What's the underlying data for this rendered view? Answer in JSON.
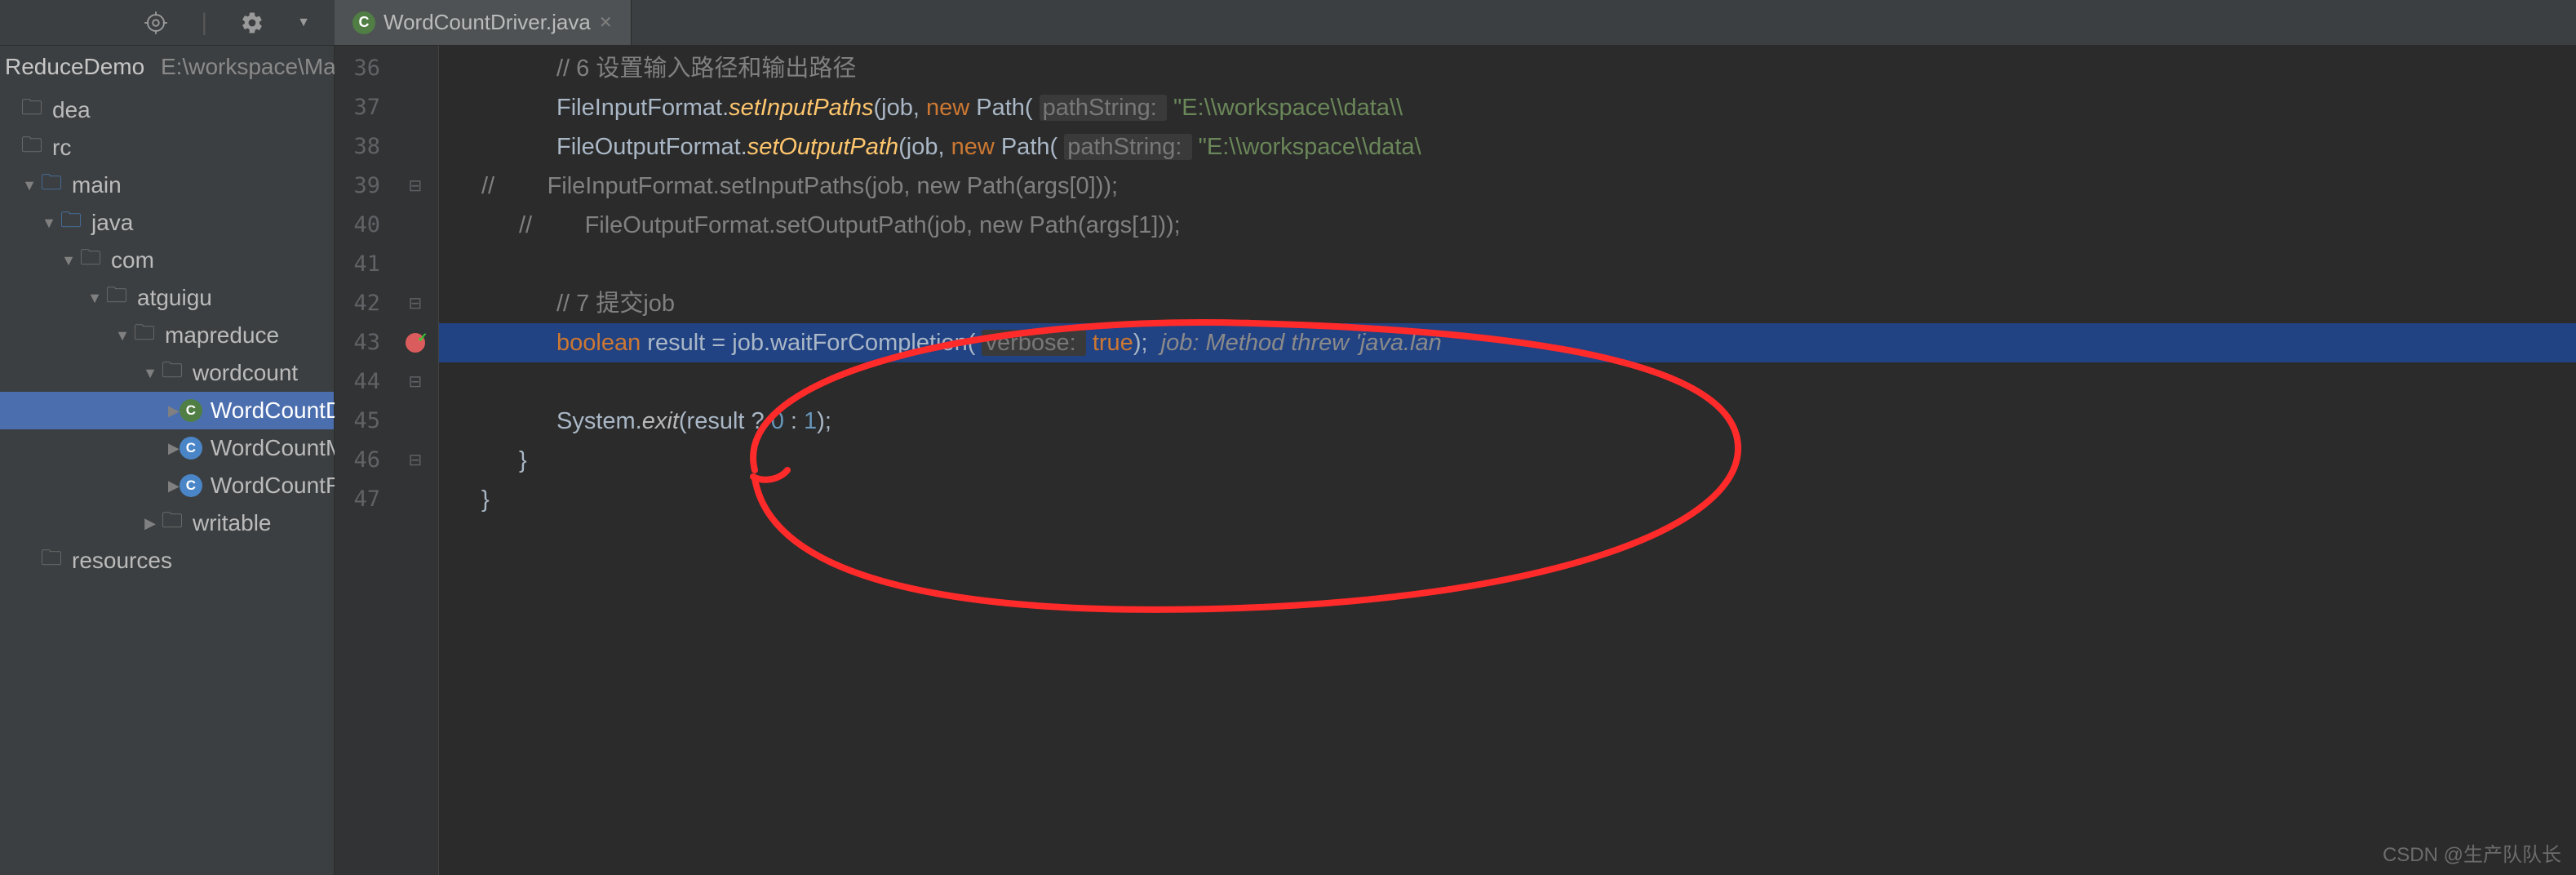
{
  "tab": {
    "name": "WordCountDriver.java"
  },
  "crumb": {
    "project": "ReduceDemo",
    "path": "E:\\workspace\\MapReduceDem"
  },
  "tree": [
    {
      "depth": 0,
      "arrow": "none",
      "icon": "folder-plain",
      "glyph": "🗀",
      "label": "dea"
    },
    {
      "depth": 0,
      "arrow": "none",
      "icon": "folder-plain",
      "glyph": "🗀",
      "label": "rc"
    },
    {
      "depth": 1,
      "arrow": "down",
      "icon": "folder-blue",
      "glyph": "🗀",
      "label": "main"
    },
    {
      "depth": 2,
      "arrow": "down",
      "icon": "folder-blue",
      "glyph": "🗀",
      "label": "java"
    },
    {
      "depth": 3,
      "arrow": "down",
      "icon": "folder-grey",
      "glyph": "🗀",
      "label": "com"
    },
    {
      "depth": 4,
      "arrow": "down",
      "icon": "folder-grey",
      "glyph": "🗀",
      "label": "atguigu"
    },
    {
      "depth": 5,
      "arrow": "down",
      "icon": "folder-grey",
      "glyph": "🗀",
      "label": "mapreduce"
    },
    {
      "depth": 6,
      "arrow": "down",
      "icon": "folder-grey",
      "glyph": "🗀",
      "label": "wordcount"
    },
    {
      "depth": 7,
      "arrow": "right",
      "icon": "class-g",
      "glyph": "C",
      "label": "WordCountDriver",
      "sel": true
    },
    {
      "depth": 7,
      "arrow": "right",
      "icon": "class-b",
      "glyph": "C",
      "label": "WordCountMapper"
    },
    {
      "depth": 7,
      "arrow": "right",
      "icon": "class-b",
      "glyph": "C",
      "label": "WordCountReducer"
    },
    {
      "depth": 6,
      "arrow": "right",
      "icon": "folder-grey",
      "glyph": "🗀",
      "label": "writable"
    },
    {
      "depth": 1,
      "arrow": "none",
      "icon": "folder-plain",
      "glyph": "🗀",
      "label": "resources"
    }
  ],
  "gutter": [
    "36",
    "37",
    "38",
    "39",
    "40",
    "41",
    "42",
    "43",
    "44",
    "45",
    "46",
    "47"
  ],
  "code": {
    "l36": "// 6 设置输入路径和输出路径",
    "l37": {
      "a": "FileInputFormat.",
      "b": "setInputPaths",
      "c": "(job, ",
      "d": "new ",
      "e": "Path( ",
      "f": "pathString: ",
      "g": "\"E:\\\\workspace\\\\data\\\\"
    },
    "l38": {
      "a": "FileOutputFormat.",
      "b": "setOutputPath",
      "c": "(job, ",
      "d": "new ",
      "e": "Path( ",
      "f": "pathString: ",
      "g": "\"E:\\\\workspace\\\\data\\"
    },
    "l39": "//        FileInputFormat.setInputPaths(job, new Path(args[0]));",
    "l40": "//        FileOutputFormat.setOutputPath(job, new Path(args[1]));",
    "l42": "// 7 提交job",
    "l43": {
      "a": "boolean ",
      "b": "result = job.waitForCompletion( ",
      "c": "verbose: ",
      "d": "true",
      "e": ");  ",
      "f": "job: Method threw 'java.lan"
    },
    "l45": {
      "a": "System.",
      "b": "exit",
      "c": "(result ? ",
      "d": "0",
      "e": " : ",
      "f": "1",
      "g": ");"
    },
    "l46": "}",
    "l47": "}"
  },
  "watermark": "CSDN @生产队队长"
}
